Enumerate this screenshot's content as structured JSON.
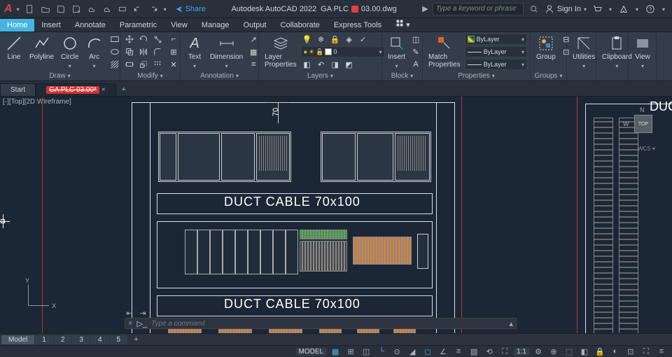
{
  "title": {
    "app": "Autodesk AutoCAD 2022",
    "filePrefix": "GA PLC",
    "fileSuffix": "03.00.dwg",
    "share": "Share"
  },
  "search": {
    "placeholder": "Type a keyword or phrase"
  },
  "signin": "Sign In",
  "menu": [
    "Home",
    "Insert",
    "Annotate",
    "Parametric",
    "View",
    "Manage",
    "Output",
    "Collaborate",
    "Express Tools"
  ],
  "ribbon": {
    "draw": {
      "title": "Draw",
      "line": "Line",
      "polyline": "Polyline",
      "circle": "Circle",
      "arc": "Arc"
    },
    "modify": {
      "title": "Modify"
    },
    "annotation": {
      "title": "Annotation",
      "text": "Text",
      "dimension": "Dimension"
    },
    "layers": {
      "title": "Layers",
      "props": "Layer\nProperties"
    },
    "block": {
      "title": "Block",
      "insert": "Insert"
    },
    "properties": {
      "title": "Properties",
      "match": "Match\nProperties",
      "bylayer": "ByLayer"
    },
    "groups": {
      "title": "Groups",
      "group": "Group"
    },
    "utilities": "Utilities",
    "clipboard": "Clipboard",
    "view": "View"
  },
  "filetabs": {
    "start": "Start",
    "active": "GA PLC 03.00*"
  },
  "viewlabel": "[-][Top][2D Wireframe]",
  "drawing": {
    "dim70": "70",
    "duct1": "DUCT CABLE 70x100",
    "duct2": "DUCT CABLE 70x100",
    "rightlabel": "DUC",
    "viewcube": "TOP",
    "wcs": "WCS",
    "ucs_x": "X",
    "ucs_y": "Y"
  },
  "cmd": {
    "placeholder": "Type a command"
  },
  "bottomtabs": {
    "model": "Model",
    "sheets": [
      "1",
      "2",
      "3",
      "4",
      "5"
    ]
  },
  "status": {
    "model": "MODEL",
    "scale": "1:1"
  }
}
